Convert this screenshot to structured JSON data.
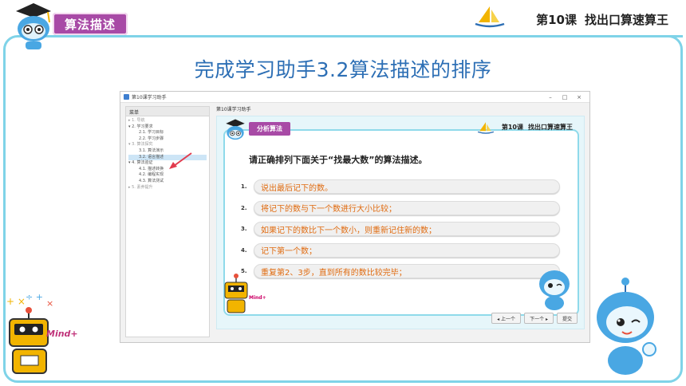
{
  "slide": {
    "header_badge": "算法描述",
    "lesson_no": "第10课",
    "lesson_name": "找出口算速算王",
    "title": "完成学习助手3.2算法描述的排序"
  },
  "window": {
    "title": "第10课学习助手",
    "controls": [
      "–",
      "□",
      "×"
    ]
  },
  "sidebar": {
    "header": "菜单",
    "items": [
      {
        "label": "▸ 1. 导航",
        "level": 1,
        "faded": true
      },
      {
        "label": "▾ 2. 学习要求",
        "level": 1,
        "faded": false
      },
      {
        "label": "2.1. 学习目标",
        "level": 2,
        "faded": false
      },
      {
        "label": "2.2. 学习步骤",
        "level": 2,
        "faded": false
      },
      {
        "label": "▾ 3. 算法探究",
        "level": 1,
        "faded": true
      },
      {
        "label": "3.1. 算法演示",
        "level": 2,
        "faded": false
      },
      {
        "label": "3.2. 语言描述",
        "level": 2,
        "faded": false,
        "selected": true
      },
      {
        "label": "▾ 4. 算法验证",
        "level": 1,
        "faded": false
      },
      {
        "label": "4.1. 描述转换",
        "level": 2,
        "faded": false
      },
      {
        "label": "4.2. 编程实现",
        "level": 2,
        "faded": false
      },
      {
        "label": "4.3. 算法测试",
        "level": 2,
        "faded": false
      },
      {
        "label": "▸ 5. 素养提升",
        "level": 1,
        "faded": true
      }
    ]
  },
  "content": {
    "title": "第10课学习助手",
    "badge": "分析算法",
    "lesson_no": "第10课",
    "lesson_name": "找出口算速算王",
    "question": "请正确排列下面关于“找最大数”的算法描述。",
    "options": [
      {
        "num": "1.",
        "text": "说出最后记下的数。"
      },
      {
        "num": "2.",
        "text": "将记下的数与下一个数进行大小比较；"
      },
      {
        "num": "3.",
        "text": "如果记下的数比下一个数小，则重新记住新的数；"
      },
      {
        "num": "4.",
        "text": "记下第一个数；"
      },
      {
        "num": "5.",
        "text": "重复第2、3步，直到所有的数比较完毕；"
      }
    ],
    "nav": {
      "prev": "◂ 上一个",
      "next": "下一个 ▸",
      "submit": "提交"
    },
    "mascot_text": "Mind+"
  },
  "mascot_text": "Mind+",
  "colors": {
    "frame": "#7fd3e8",
    "badge": "#a84aa6",
    "title": "#2d6fb5",
    "option_text": "#e06b10"
  }
}
